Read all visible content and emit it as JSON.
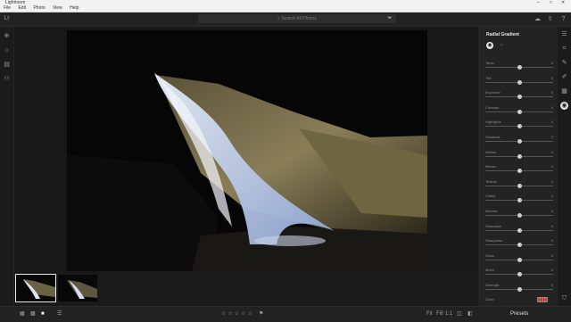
{
  "app": {
    "title": "Lightroom"
  },
  "menu": [
    "File",
    "Edit",
    "Photo",
    "View",
    "Help"
  ],
  "window_controls": [
    "–",
    "□",
    "✕"
  ],
  "search": {
    "placeholder": "Search All Photos"
  },
  "left_toolbar_icons": [
    "lr-logo-icon",
    "add-photos-icon",
    "home-icon",
    "library-icon",
    "people-icon"
  ],
  "top_icons": [
    "cloud-sync-icon",
    "share-icon",
    "help-icon"
  ],
  "panel": {
    "title": "Radial Gradient",
    "modes": [
      "radial-gradient-mode-icon",
      "brush-mode-icon"
    ],
    "sliders": [
      {
        "label": "Temp",
        "value": 0.5,
        "val": "0"
      },
      {
        "label": "Tint",
        "value": 0.5,
        "val": "0"
      },
      {
        "label": "Exposure",
        "value": 0.5,
        "val": "0"
      },
      {
        "label": "Contrast",
        "value": 0.5,
        "val": "0"
      },
      {
        "label": "Highlights",
        "value": 0.5,
        "val": "0"
      },
      {
        "label": "Shadows",
        "value": 0.5,
        "val": "0"
      },
      {
        "label": "Whites",
        "value": 0.5,
        "val": "0"
      },
      {
        "label": "Blacks",
        "value": 0.5,
        "val": "0"
      },
      {
        "label": "Texture",
        "value": 0.5,
        "val": "0"
      },
      {
        "label": "Clarity",
        "value": 0.5,
        "val": "0"
      },
      {
        "label": "Dehaze",
        "value": 0.5,
        "val": "0"
      },
      {
        "label": "Saturation",
        "value": 0.5,
        "val": "0"
      },
      {
        "label": "Sharpness",
        "value": 0.5,
        "val": "0"
      },
      {
        "label": "Noise",
        "value": 0.5,
        "val": "0"
      },
      {
        "label": "Moiré",
        "value": 0.5,
        "val": "0"
      },
      {
        "label": "Defringe",
        "value": 0.5,
        "val": "0"
      }
    ],
    "color_label": "Color"
  },
  "right_rail_icons": [
    "edit-sliders-icon",
    "crop-icon",
    "healing-brush-icon",
    "brush-icon",
    "linear-gradient-icon",
    "radial-gradient-icon",
    "tag-icon",
    "info-icon",
    "comment-icon"
  ],
  "bottom_bar": {
    "fit": "Fit",
    "fill": "Fill",
    "ratio": "1:1",
    "presets": "Presets"
  },
  "colors": {
    "accent": "#e9e9e9",
    "panel_bg": "#232323",
    "app_bg": "#1e1e1e"
  }
}
